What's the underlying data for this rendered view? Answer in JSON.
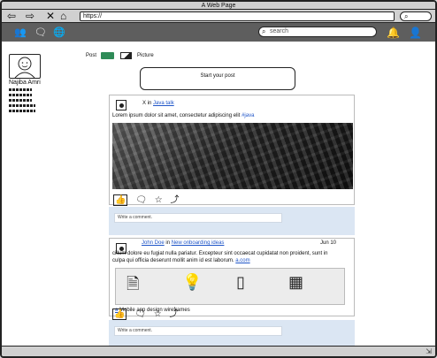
{
  "window": {
    "title": "A Web Page"
  },
  "browser": {
    "url": "https://"
  },
  "topnav": {
    "search_placeholder": "search"
  },
  "profile": {
    "name": "Najiba Amri"
  },
  "composer": {
    "post_label": "Post",
    "picture_label": "Picture",
    "start_label": "Start your post"
  },
  "post1": {
    "group_prefix": "X in",
    "group_link": "Java talk",
    "text": "Lorem ipsum dolor sit amet, consectetur adipiscing elit",
    "hashtag": "#java"
  },
  "comments": {
    "placeholder": "Write a comment."
  },
  "post2": {
    "author": "John Doe",
    "in_word": "in",
    "group_link": "New onboarding ideas",
    "date": "Jun 10",
    "text": "cillum dolore eu fugiat nulla pariatur. Excepteur sint occaecat cupidatat non proident, sunt in culpa qui officia deserunt mollit anim id est laborum.",
    "text_link": "a.com",
    "attachment_label": "Mobile app design wireframes",
    "attachment_marker": "a"
  }
}
